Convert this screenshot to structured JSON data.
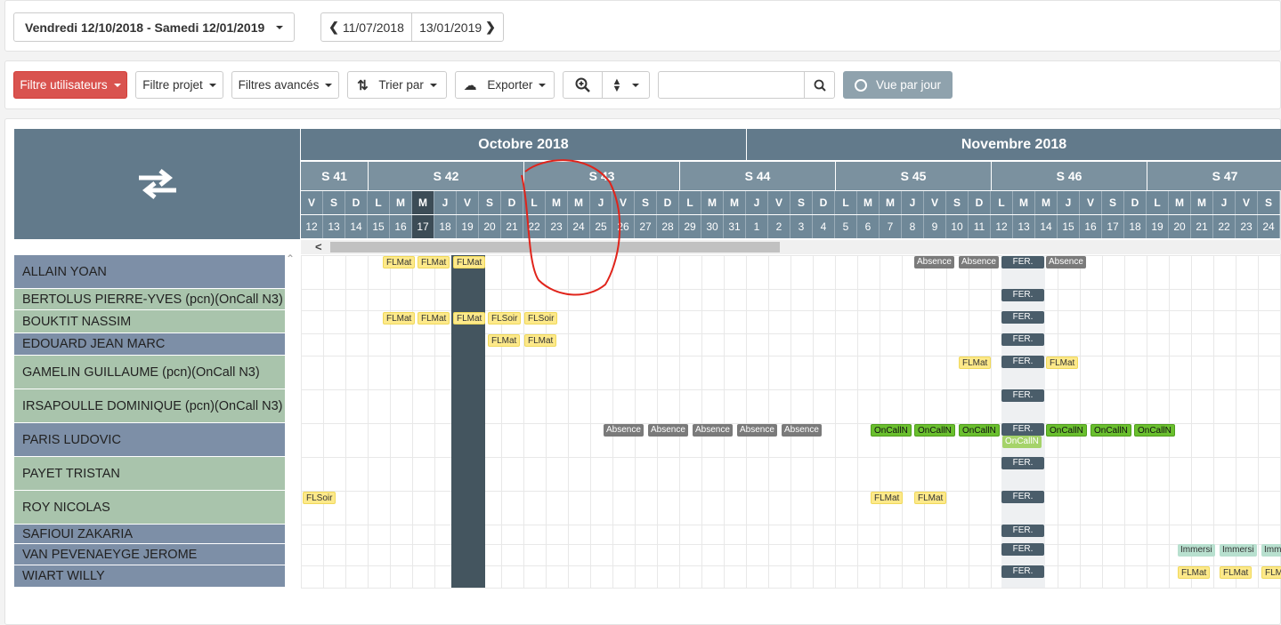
{
  "date_range": {
    "label": "Vendredi 12/10/2018 - Samedi 12/01/2019"
  },
  "nav": {
    "prev": "11/07/2018",
    "next": "13/01/2019"
  },
  "toolbar": {
    "filter_users": "Filtre utilisateurs",
    "filter_project": "Filtre projet",
    "filter_advanced": "Filtres avancés",
    "sort": "Trier par",
    "export": "Exporter",
    "view_day": "Vue par jour",
    "search_value": ""
  },
  "months": [
    "Octobre 2018",
    "Novembre 2018"
  ],
  "weeks": [
    "S 41",
    "S 42",
    "S 43",
    "S 44",
    "S 45",
    "S 46",
    "S 47"
  ],
  "days": [
    {
      "l": "V",
      "n": "12"
    },
    {
      "l": "S",
      "n": "13"
    },
    {
      "l": "D",
      "n": "14"
    },
    {
      "l": "L",
      "n": "15"
    },
    {
      "l": "M",
      "n": "16"
    },
    {
      "l": "M",
      "n": "17"
    },
    {
      "l": "J",
      "n": "18"
    },
    {
      "l": "V",
      "n": "19"
    },
    {
      "l": "S",
      "n": "20"
    },
    {
      "l": "D",
      "n": "21"
    },
    {
      "l": "L",
      "n": "22"
    },
    {
      "l": "M",
      "n": "23"
    },
    {
      "l": "M",
      "n": "24"
    },
    {
      "l": "J",
      "n": "25"
    },
    {
      "l": "V",
      "n": "26"
    },
    {
      "l": "S",
      "n": "27"
    },
    {
      "l": "D",
      "n": "28"
    },
    {
      "l": "L",
      "n": "29"
    },
    {
      "l": "M",
      "n": "30"
    },
    {
      "l": "M",
      "n": "31"
    },
    {
      "l": "J",
      "n": "1"
    },
    {
      "l": "V",
      "n": "2"
    },
    {
      "l": "S",
      "n": "3"
    },
    {
      "l": "D",
      "n": "4"
    },
    {
      "l": "L",
      "n": "5"
    },
    {
      "l": "M",
      "n": "6"
    },
    {
      "l": "M",
      "n": "7"
    },
    {
      "l": "J",
      "n": "8"
    },
    {
      "l": "V",
      "n": "9"
    },
    {
      "l": "S",
      "n": "10"
    },
    {
      "l": "D",
      "n": "11"
    },
    {
      "l": "L",
      "n": "12"
    },
    {
      "l": "M",
      "n": "13"
    },
    {
      "l": "M",
      "n": "14"
    },
    {
      "l": "J",
      "n": "15"
    },
    {
      "l": "V",
      "n": "16"
    },
    {
      "l": "S",
      "n": "17"
    },
    {
      "l": "D",
      "n": "18"
    },
    {
      "l": "L",
      "n": "19"
    },
    {
      "l": "M",
      "n": "20"
    },
    {
      "l": "M",
      "n": "21"
    },
    {
      "l": "J",
      "n": "22"
    },
    {
      "l": "V",
      "n": "23"
    },
    {
      "l": "S",
      "n": "24"
    }
  ],
  "users": [
    "ALLAIN YOAN",
    "BERTOLUS PIERRE-YVES (pcn)(OnCall N3)",
    "BOUKTIT NASSIM",
    "EDOUARD JEAN MARC",
    "GAMELIN GUILLAUME (pcn)(OnCall N3)",
    "IRSAPOULLE DOMINIQUE (pcn)(OnCall N3)",
    "PARIS LUDOVIC",
    "PAYET TRISTAN",
    "ROY NICOLAS",
    "SAFIOUI ZAKARIA",
    "VAN PEVENAEYGE JEROME",
    "WIART WILLY"
  ],
  "tags": {
    "flmat": "FLMat",
    "flsoir": "FLSoir",
    "absence": "Absence",
    "fer": "FER.",
    "oncall": "OnCallN",
    "immersion": "Immersi",
    "imm_cut": "Imm",
    "flm_cut": "FLM"
  },
  "colors": {
    "primary": "#d9534f",
    "header": "#627a8b",
    "today": "#44555f",
    "user_blue": "#7d8fa7",
    "user_green": "#a9c4ac"
  }
}
